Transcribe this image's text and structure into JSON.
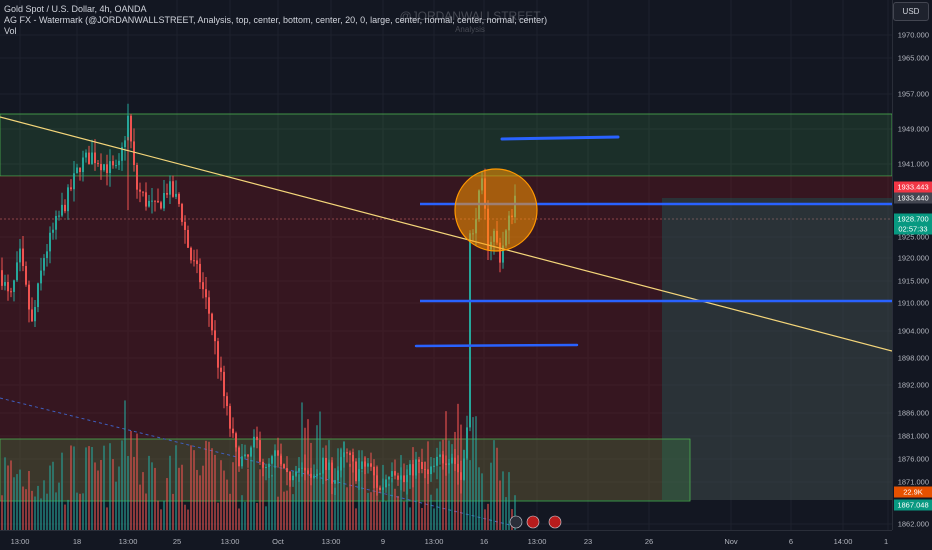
{
  "legend": {
    "line1": "Gold Spot / U.S. Dollar, 4h, OANDA",
    "line2": "AG FX - Watermark (@JORDANWALLSTREET, Analysis, top, center, bottom, center, 20, 0, large, center, normal, center, normal, center)",
    "line3": "Vol"
  },
  "watermark": {
    "title": "@JORDANWALLSTREET",
    "subtitle": "Analysis"
  },
  "currency": "USD",
  "price_axis": {
    "ticks": [
      "1970.000",
      "1965.000",
      "1957.000",
      "1949.000",
      "1941.000",
      "1925.000",
      "1920.000",
      "1915.000",
      "1910.000",
      "1904.000",
      "1898.000",
      "1892.000",
      "1886.000",
      "1881.000",
      "1876.000",
      "1871.000",
      "1862.000"
    ]
  },
  "price_tags": {
    "high": "1933.443",
    "level": "1933.440",
    "last_price": "1928.700",
    "countdown": "02:57:33",
    "volume_pct": "22.9K",
    "low": "1867.048"
  },
  "time_axis": {
    "labels": [
      "13:00",
      "18",
      "13:00",
      "25",
      "13:00",
      "Oct",
      "13:00",
      "9",
      "13:00",
      "16",
      "13:00",
      "23",
      "26",
      "Nov",
      "6",
      "14:00",
      "1"
    ]
  },
  "colors": {
    "up": "#26a69a",
    "down": "#ef5350",
    "trendline": "#f5d67a",
    "annotation": "#2962ff",
    "circle": "#ff9800"
  },
  "chart_data": {
    "type": "candlestick",
    "title": "Gold Spot / U.S. Dollar, 4h, OANDA",
    "y_range": [
      1860,
      1975
    ],
    "annotations": [
      "descending trendline",
      "horizontal levels 1948, 1933, 1911, 1901",
      "circle near 1930"
    ],
    "volume_series_label": "Vol"
  }
}
